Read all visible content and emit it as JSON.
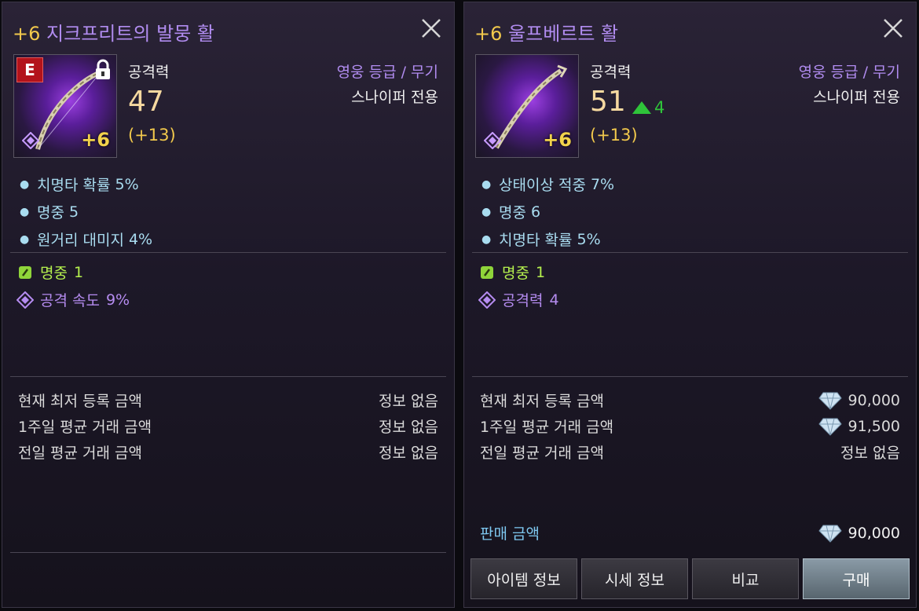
{
  "left": {
    "enhance_prefix": "+6",
    "name": "지크프리트의 발뭉 활",
    "grade_badge": "E",
    "enhance_badge": "+6",
    "stat_label": "공격력",
    "stat_value": "47",
    "stat_bonus": "(+13)",
    "grade_text": "영웅 등급 / 무기",
    "class_text": "스나이퍼 전용",
    "options": [
      {
        "name": "치명타 확률",
        "value": "5%"
      },
      {
        "name": "명중",
        "value": "5"
      },
      {
        "name": "원거리 대미지",
        "value": "4%"
      }
    ],
    "extra_green": {
      "name": "명중",
      "value": "1"
    },
    "extra_purple": {
      "name": "공격 속도",
      "value": "9%"
    },
    "prices": [
      {
        "label": "현재 최저 등록 금액",
        "value": "정보 없음"
      },
      {
        "label": "1주일 평균 거래 금액",
        "value": "정보 없음"
      },
      {
        "label": "전일 평균 거래 금액",
        "value": "정보 없음"
      }
    ]
  },
  "right": {
    "enhance_prefix": "+6",
    "name": "울프베르트 활",
    "enhance_badge": "+6",
    "stat_label": "공격력",
    "stat_value": "51",
    "stat_diff": "4",
    "stat_bonus": "(+13)",
    "grade_text": "영웅 등급 / 무기",
    "class_text": "스나이퍼 전용",
    "options": [
      {
        "name": "상태이상 적중",
        "value": "7%"
      },
      {
        "name": "명중",
        "value": "6"
      },
      {
        "name": "치명타 확률",
        "value": "5%"
      }
    ],
    "extra_green": {
      "name": "명중",
      "value": "1"
    },
    "extra_purple": {
      "name": "공격력",
      "value": "4"
    },
    "prices": [
      {
        "label": "현재 최저 등록 금액",
        "value": "90,000"
      },
      {
        "label": "1주일 평균 거래 금액",
        "value": "91,500"
      },
      {
        "label": "전일 평균 거래 금액",
        "value": "정보 없음"
      }
    ],
    "sell_label": "판매 금액",
    "sell_value": "90,000",
    "buttons": {
      "item_info": "아이템 정보",
      "market_info": "시세 정보",
      "compare": "비교",
      "buy": "구매"
    }
  }
}
